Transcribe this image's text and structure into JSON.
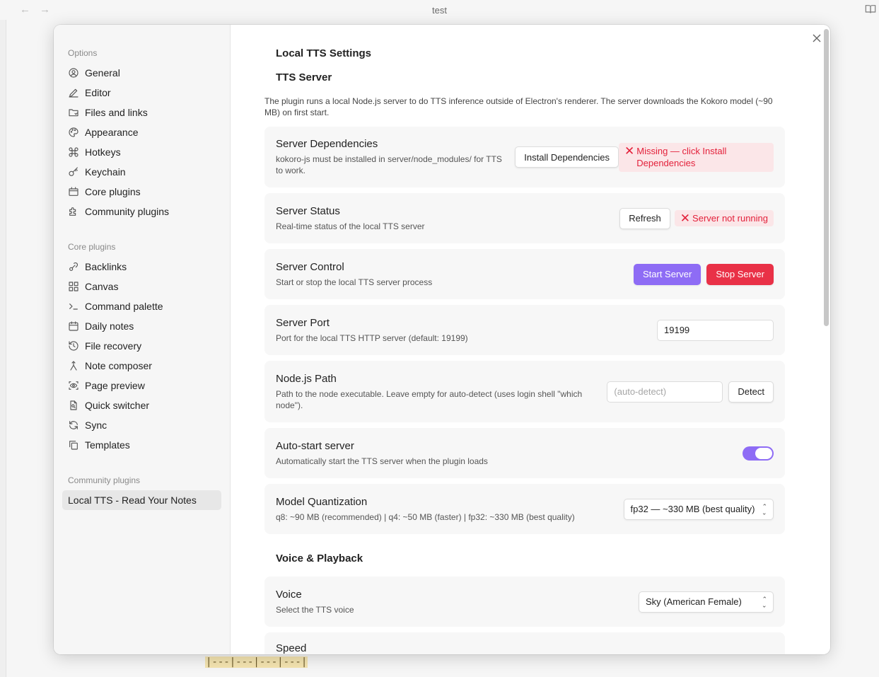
{
  "window": {
    "title": "test"
  },
  "background": {
    "table_fragment": "|---|---|---|---|"
  },
  "sidebar": {
    "options_heading": "Options",
    "options": [
      {
        "label": "General",
        "icon": "user-circle-icon"
      },
      {
        "label": "Editor",
        "icon": "pencil-icon"
      },
      {
        "label": "Files and links",
        "icon": "folder-icon"
      },
      {
        "label": "Appearance",
        "icon": "palette-icon"
      },
      {
        "label": "Hotkeys",
        "icon": "command-icon"
      },
      {
        "label": "Keychain",
        "icon": "key-icon"
      },
      {
        "label": "Core plugins",
        "icon": "box-icon"
      },
      {
        "label": "Community plugins",
        "icon": "puzzle-icon"
      }
    ],
    "core_heading": "Core plugins",
    "core": [
      {
        "label": "Backlinks",
        "icon": "link-icon"
      },
      {
        "label": "Canvas",
        "icon": "grid-icon"
      },
      {
        "label": "Command palette",
        "icon": "terminal-icon"
      },
      {
        "label": "Daily notes",
        "icon": "calendar-icon"
      },
      {
        "label": "File recovery",
        "icon": "history-icon"
      },
      {
        "label": "Note composer",
        "icon": "merge-icon"
      },
      {
        "label": "Page preview",
        "icon": "scan-eye-icon"
      },
      {
        "label": "Quick switcher",
        "icon": "file-search-icon"
      },
      {
        "label": "Sync",
        "icon": "sync-icon"
      },
      {
        "label": "Templates",
        "icon": "copy-icon"
      }
    ],
    "community_heading": "Community plugins",
    "community": [
      {
        "label": "Local TTS - Read Your Notes",
        "active": true
      }
    ]
  },
  "content": {
    "title": "Local TTS Settings",
    "server_heading": "TTS Server",
    "server_desc": "The plugin runs a local Node.js server to do TTS inference outside of Electron's renderer. The server downloads the Kokoro model (~90 MB) on first start.",
    "settings": {
      "deps": {
        "name": "Server Dependencies",
        "desc": "kokoro-js must be installed in server/node_modules/ for TTS to work.",
        "button": "Install Dependencies",
        "status": "Missing — click Install Dependencies"
      },
      "status": {
        "name": "Server Status",
        "desc": "Real-time status of the local TTS server",
        "button": "Refresh",
        "status": "Server not running"
      },
      "control": {
        "name": "Server Control",
        "desc": "Start or stop the local TTS server process",
        "start": "Start Server",
        "stop": "Stop Server"
      },
      "port": {
        "name": "Server Port",
        "desc": "Port for the local TTS HTTP server (default: 19199)",
        "value": "19199"
      },
      "node": {
        "name": "Node.js Path",
        "desc": "Path to the node executable. Leave empty for auto-detect (uses login shell \"which node\").",
        "placeholder": "(auto-detect)",
        "button": "Detect"
      },
      "autostart": {
        "name": "Auto-start server",
        "desc": "Automatically start the TTS server when the plugin loads",
        "enabled": true
      },
      "quant": {
        "name": "Model Quantization",
        "desc": "q8: ~90 MB (recommended) | q4: ~50 MB (faster) | fp32: ~330 MB (best quality)",
        "selected": "fp32 — ~330 MB (best quality)"
      }
    },
    "voice_heading": "Voice & Playback",
    "voice": {
      "name": "Voice",
      "desc": "Select the TTS voice",
      "selected": "Sky (American Female)"
    },
    "speed": {
      "name": "Speed"
    }
  },
  "colors": {
    "accent": "#8e6cf5",
    "danger": "#e93147",
    "error_bg": "#fbe6e8"
  }
}
